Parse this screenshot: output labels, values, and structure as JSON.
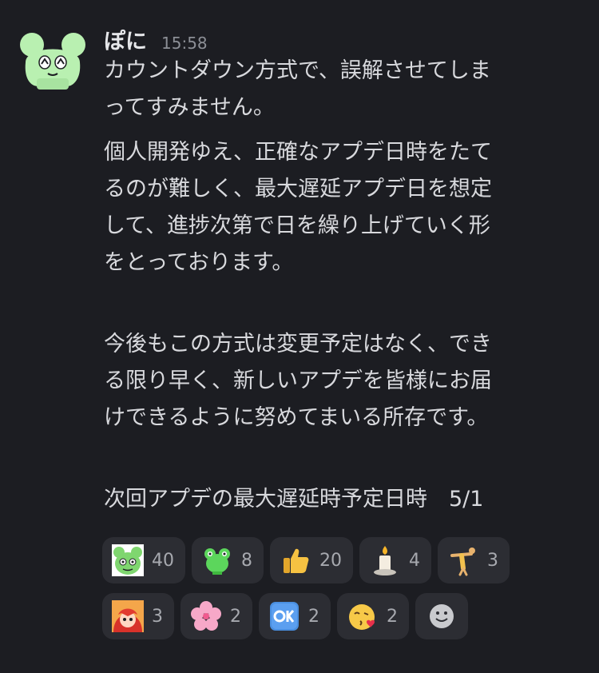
{
  "post": {
    "username": "ぽに",
    "timestamp": "15:58",
    "avatar_icon": "green-mouse-avatar-icon",
    "lines": [
      "カウントダウン方式で、誤解させてしま",
      "ってすみません。",
      "個人開発ゆえ、正確なアプデ日時をたて",
      "るのが難しく、最大遅延アプデ日を想定",
      "して、進捗次第で日を繰り上げていく形",
      "をとっております。",
      "今後もこの方式は変更予定はなく、でき",
      "る限り早く、新しいアプデを皆様にお届",
      "けできるように努めてまいる所存です。",
      "次回アプデの最大遅延時予定日時　5/1"
    ]
  },
  "reactions": [
    {
      "icon": "green-mouse-face-icon",
      "count": "40"
    },
    {
      "icon": "green-frog-icon",
      "count": "8"
    },
    {
      "icon": "thumbs-up-icon",
      "count": "20"
    },
    {
      "icon": "candle-icon",
      "count": "4"
    },
    {
      "icon": "gymnast-icon",
      "count": "3"
    },
    {
      "icon": "red-hair-character-icon",
      "count": "3"
    },
    {
      "icon": "cherry-blossom-icon",
      "count": "2"
    },
    {
      "icon": "ok-button-icon",
      "count": "2"
    },
    {
      "icon": "blowing-kiss-icon",
      "count": "2"
    }
  ],
  "add_reaction_icon": "smiley-add-reaction-icon",
  "colors": {
    "background": "#1c1d22",
    "reaction_bg": "#2c2d33",
    "text": "#d8d9dd",
    "muted": "#8c8f96",
    "avatar_green": "#b9f0b1"
  }
}
